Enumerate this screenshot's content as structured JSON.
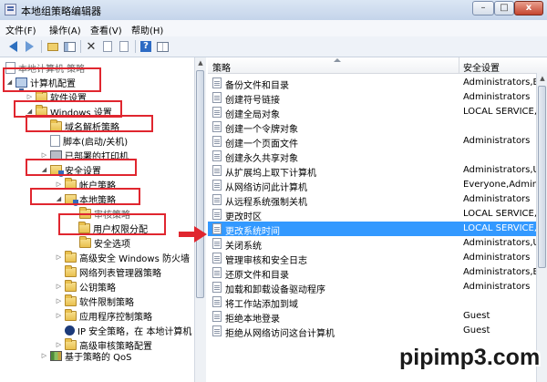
{
  "window": {
    "title": "本地组策略编辑器",
    "min_glyph": "–",
    "max_glyph": "□",
    "close_glyph": "x"
  },
  "menu": [
    {
      "label": "文件(F)"
    },
    {
      "label": "操作(A)"
    },
    {
      "label": "查看(V)"
    },
    {
      "label": "帮助(H)"
    }
  ],
  "toolbar": {
    "delete_glyph": "✕",
    "help_glyph": "?"
  },
  "tree": {
    "items": [
      {
        "label": "本地计算机 策略"
      },
      {
        "label": "计算机配置"
      },
      {
        "label": "软件设置"
      },
      {
        "label": "Windows 设置"
      },
      {
        "label": "域名解析策略"
      },
      {
        "label": "脚本(启动/关机)"
      },
      {
        "label": "已部署的打印机"
      },
      {
        "label": "安全设置"
      },
      {
        "label": "帐户策略"
      },
      {
        "label": "本地策略"
      },
      {
        "label": "审核策略"
      },
      {
        "label": "用户权限分配"
      },
      {
        "label": "安全选项"
      },
      {
        "label": "高级安全 Windows 防火墙"
      },
      {
        "label": "网络列表管理器策略"
      },
      {
        "label": "公钥策略"
      },
      {
        "label": "软件限制策略"
      },
      {
        "label": "应用程序控制策略"
      },
      {
        "label": "IP 安全策略，在 本地计算机"
      },
      {
        "label": "高级审核策略配置"
      },
      {
        "label": "基于策略的 QoS"
      }
    ]
  },
  "list": {
    "columns": {
      "policy": "策略",
      "setting": "安全设置"
    },
    "rows": [
      {
        "policy": "备份文件和目录",
        "setting": "Administrators,B"
      },
      {
        "policy": "创建符号链接",
        "setting": "Administrators"
      },
      {
        "policy": "创建全局对象",
        "setting": "LOCAL SERVICE,N"
      },
      {
        "policy": "创建一个令牌对象",
        "setting": ""
      },
      {
        "policy": "创建一个页面文件",
        "setting": "Administrators"
      },
      {
        "policy": "创建永久共享对象",
        "setting": ""
      },
      {
        "policy": "从扩展坞上取下计算机",
        "setting": "Administrators,U"
      },
      {
        "policy": "从网络访问此计算机",
        "setting": "Everyone,Admin"
      },
      {
        "policy": "从远程系统强制关机",
        "setting": "Administrators"
      },
      {
        "policy": "更改时区",
        "setting": "LOCAL SERVICE,A"
      },
      {
        "policy": "更改系统时间",
        "setting": "LOCAL SERVICE,A"
      },
      {
        "policy": "关闭系统",
        "setting": "Administrators,U"
      },
      {
        "policy": "管理审核和安全日志",
        "setting": "Administrators"
      },
      {
        "policy": "还原文件和目录",
        "setting": "Administrators,B"
      },
      {
        "policy": "加载和卸载设备驱动程序",
        "setting": "Administrators"
      },
      {
        "policy": "将工作站添加到域",
        "setting": ""
      },
      {
        "policy": "拒绝本地登录",
        "setting": "Guest"
      },
      {
        "policy": "拒绝从网络访问这台计算机",
        "setting": "Guest"
      }
    ]
  },
  "watermark": "pipimp3.com"
}
